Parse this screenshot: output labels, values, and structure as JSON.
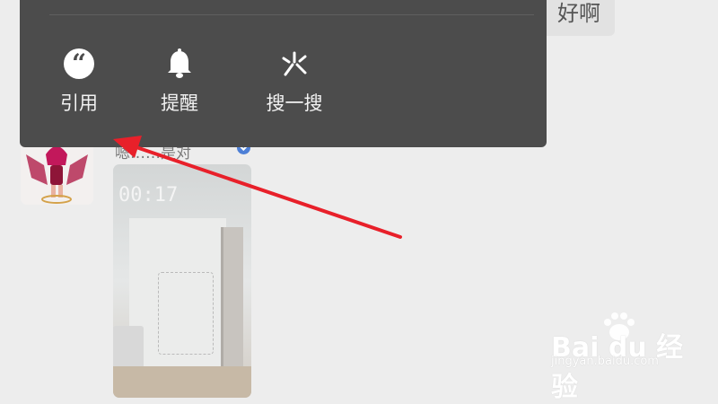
{
  "chat": {
    "bubble_text": "好啊",
    "sender_name": "嗯……是对",
    "video": {
      "duration_label": "00:17"
    }
  },
  "context_menu": {
    "items": [
      {
        "label": "引用",
        "icon": "quote-icon"
      },
      {
        "label": "提醒",
        "icon": "bell-icon"
      },
      {
        "label": "搜一搜",
        "icon": "search-spark-icon"
      }
    ]
  },
  "annotation": {
    "arrow_color": "#e8202a"
  },
  "watermark": {
    "brand": "Bai du 经验",
    "url": "jingyan.baidu.com"
  },
  "colors": {
    "menu_bg": "#4c4c4c",
    "chat_bg": "#ededed",
    "verified": "#4d7fd6"
  }
}
